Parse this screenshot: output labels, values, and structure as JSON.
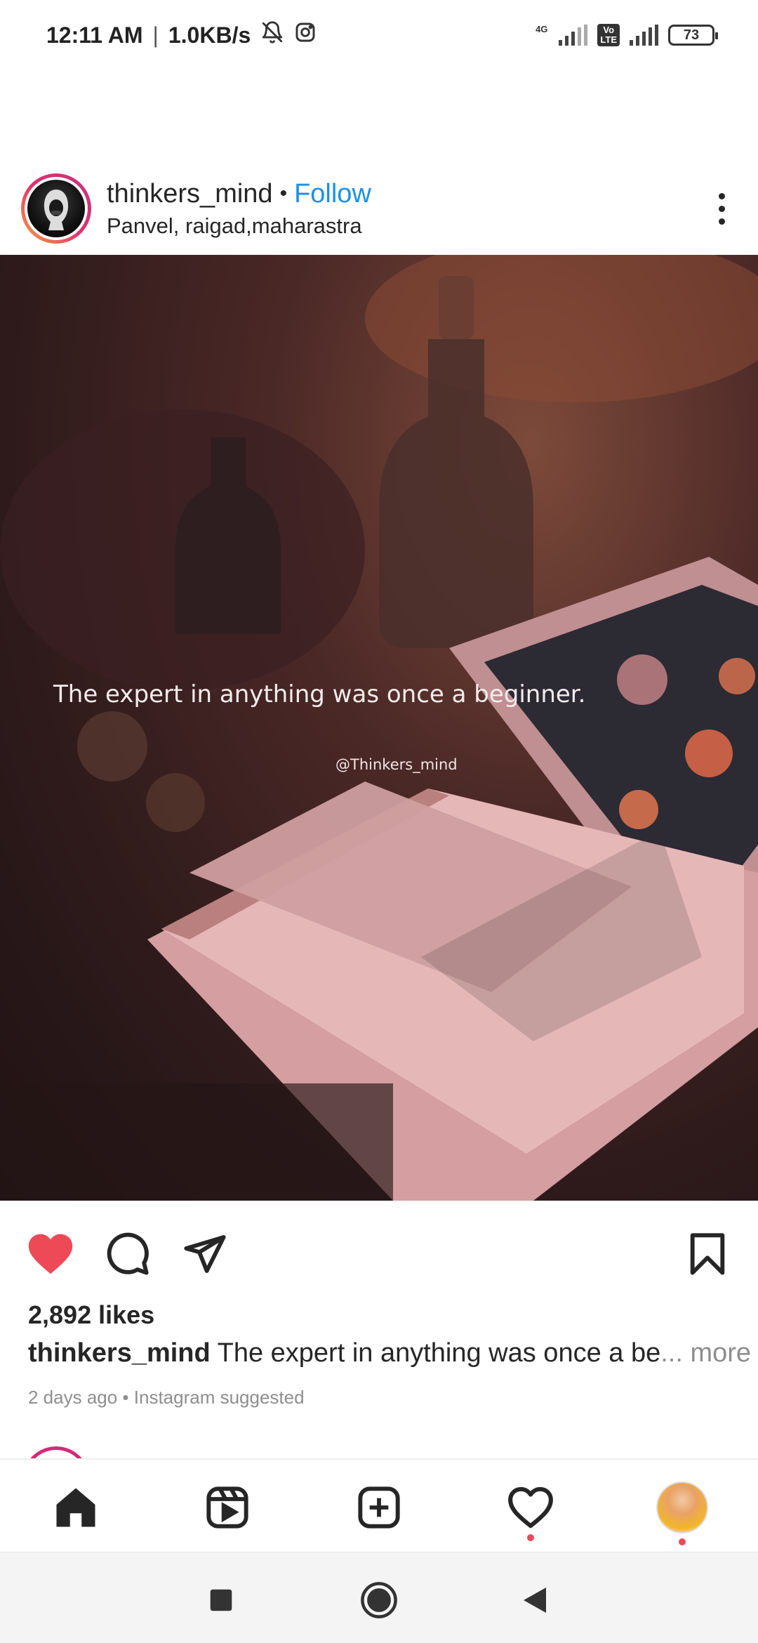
{
  "status_bar": {
    "time": "12:11 AM",
    "separator": "|",
    "speed": "1.0KB/s",
    "network_badge": "4G",
    "volte_label": "Vo\nLTE",
    "battery": "73",
    "icons": [
      "mute-bell-icon",
      "instagram-icon",
      "signal-icon",
      "volte-icon",
      "signal-icon",
      "battery-icon"
    ]
  },
  "post": {
    "username": "thinkers_mind",
    "dot": "•",
    "follow_label": "Follow",
    "location": "Panvel, raigad,maharastra",
    "image_quote": "The expert in anything was once a beginner.",
    "image_watermark": "@Thinkers_mind",
    "likes": "2,892 likes",
    "caption_user": "thinkers_mind",
    "caption_text": "The expert in anything was once a be",
    "caption_more": "... more",
    "meta": "2 days ago • Instagram suggested",
    "liked": true,
    "colors": {
      "follow": "#1a91e6",
      "like": "#ed4956",
      "secondary_text": "#8e8e8e"
    }
  },
  "bottom_nav": {
    "items": [
      "home-icon",
      "reels-icon",
      "create-icon",
      "activity-icon",
      "profile-avatar"
    ]
  },
  "system_nav": {
    "items": [
      "recents-button",
      "home-button",
      "back-button"
    ]
  }
}
